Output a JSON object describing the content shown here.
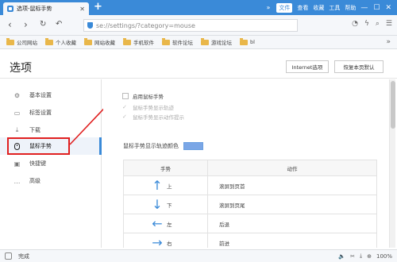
{
  "browser": {
    "tab_title": "选项-鼠标手势",
    "tab_close": "✕",
    "new_tab": "+",
    "menu": [
      "文件",
      "查看",
      "收藏",
      "工具",
      "帮助"
    ],
    "window_buttons": [
      "—",
      "☐",
      "✕"
    ],
    "url": "se://settings/?category=mouse"
  },
  "bookmarks": [
    {
      "label": "公司网站",
      "icon": "folder-icon"
    },
    {
      "label": "个人收藏",
      "icon": "folder-icon"
    },
    {
      "label": "网站收藏",
      "icon": "folder-icon"
    },
    {
      "label": "手机软件",
      "icon": "folder-icon"
    },
    {
      "label": "软件论坛",
      "icon": "folder-icon"
    },
    {
      "label": "游戏论坛",
      "icon": "folder-icon"
    },
    {
      "label": "bl",
      "icon": "folder-icon"
    }
  ],
  "header": {
    "title": "选项",
    "internet_options": "Internet选项",
    "restore_default": "恢复本页默认"
  },
  "sidebar": {
    "items": [
      {
        "label": "基本设置",
        "icon": "gear-icon"
      },
      {
        "label": "标签设置",
        "icon": "tabs-icon"
      },
      {
        "label": "下载",
        "icon": "download-icon"
      },
      {
        "label": "鼠标手势",
        "icon": "mouse-icon"
      },
      {
        "label": "快捷键",
        "icon": "keyboard-icon"
      },
      {
        "label": "高级",
        "icon": "more-icon"
      }
    ]
  },
  "content": {
    "enable_gesture": "启用鼠标手势",
    "show_trail": "鼠标手势显示轨迹",
    "show_hint": "鼠标手势显示动作提示",
    "trail_color_label": "鼠标手势显示轨迹颜色",
    "trail_color": "#7aa6e6",
    "table": {
      "headers": [
        "手势",
        "动作"
      ],
      "rows": [
        {
          "arrow": "↑",
          "dir": "上",
          "action": "滚屏到页首"
        },
        {
          "arrow": "↓",
          "dir": "下",
          "action": "滚屏到页尾"
        },
        {
          "arrow": "←",
          "dir": "左",
          "action": "后退"
        },
        {
          "arrow": "→",
          "dir": "右",
          "action": "前进"
        }
      ]
    }
  },
  "status": {
    "text": "完成",
    "zoom": "100%"
  },
  "colors": {
    "accent": "#3a8ad8",
    "highlight": "#e02020"
  }
}
